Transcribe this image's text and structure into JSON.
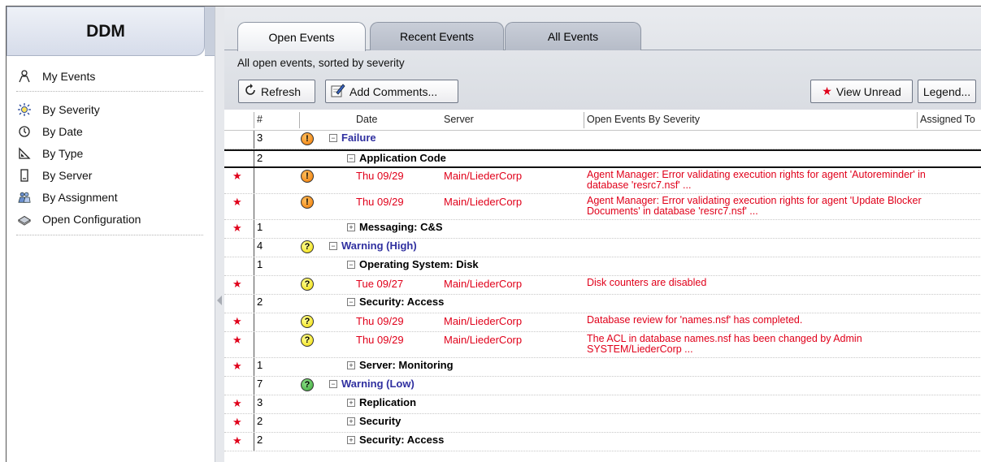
{
  "sidebar": {
    "title": "DDM",
    "items": [
      {
        "label": "My Events",
        "icon": "person-icon"
      },
      {
        "label": "By Severity",
        "icon": "severity-icon"
      },
      {
        "label": "By Date",
        "icon": "clock-icon"
      },
      {
        "label": "By Type",
        "icon": "type-icon"
      },
      {
        "label": "By Server",
        "icon": "server-icon"
      },
      {
        "label": "By Assignment",
        "icon": "people-icon"
      },
      {
        "label": "Open Configuration",
        "icon": "configuration-icon"
      }
    ]
  },
  "tabs": [
    {
      "label": "Open Events",
      "active": true
    },
    {
      "label": "Recent Events",
      "active": false
    },
    {
      "label": "All Events",
      "active": false
    }
  ],
  "subtitle": "All open events, sorted by severity",
  "toolbar": {
    "refresh_label": "Refresh",
    "add_comments_label": "Add Comments...",
    "view_unread_label": "View Unread",
    "legend_label": "Legend..."
  },
  "columns": {
    "count": "#",
    "date": "Date",
    "server": "Server",
    "summary": "Open Events By Severity",
    "assigned": "Assigned To"
  },
  "rows": [
    {
      "kind": "cat1",
      "count": "3",
      "severity": "fail",
      "label": "Failure",
      "expanded": true
    },
    {
      "kind": "cat2",
      "count": "2",
      "label": "Application Code",
      "expanded": true,
      "selected": true
    },
    {
      "kind": "event",
      "unread": true,
      "severity": "fail",
      "date": "Thu 09/29",
      "server": "Main/LiederCorp",
      "message": "Agent Manager: Error validating execution rights for agent 'Autoreminder' in database 'resrc7.nsf' ..."
    },
    {
      "kind": "event",
      "unread": true,
      "severity": "fail",
      "date": "Thu 09/29",
      "server": "Main/LiederCorp",
      "message": "Agent Manager: Error validating execution rights for agent 'Update Blocker Documents' in database 'resrc7.nsf' ..."
    },
    {
      "kind": "cat2",
      "unread": true,
      "count": "1",
      "label": "Messaging: C&S",
      "expanded": false
    },
    {
      "kind": "cat1",
      "count": "4",
      "severity": "high",
      "label": "Warning (High)",
      "expanded": true
    },
    {
      "kind": "cat2",
      "count": "1",
      "label": "Operating System: Disk",
      "expanded": true
    },
    {
      "kind": "event",
      "unread": true,
      "severity": "high",
      "date": "Tue 09/27",
      "server": "Main/LiederCorp",
      "message": "Disk counters are disabled"
    },
    {
      "kind": "cat2",
      "count": "2",
      "label": "Security: Access",
      "expanded": true
    },
    {
      "kind": "event",
      "unread": true,
      "severity": "high",
      "date": "Thu 09/29",
      "server": "Main/LiederCorp",
      "message": "Database review for 'names.nsf' has completed."
    },
    {
      "kind": "event",
      "unread": true,
      "severity": "high",
      "date": "Thu 09/29",
      "server": "Main/LiederCorp",
      "message": "The ACL in database names.nsf has been changed by Admin SYSTEM/LiederCorp ..."
    },
    {
      "kind": "cat2",
      "unread": true,
      "count": "1",
      "label": "Server: Monitoring",
      "expanded": false
    },
    {
      "kind": "cat1",
      "count": "7",
      "severity": "low",
      "label": "Warning (Low)",
      "expanded": true
    },
    {
      "kind": "cat2",
      "unread": true,
      "count": "3",
      "label": "Replication",
      "expanded": false
    },
    {
      "kind": "cat2",
      "unread": true,
      "count": "2",
      "label": "Security",
      "expanded": false
    },
    {
      "kind": "cat2",
      "unread": true,
      "count": "2",
      "label": "Security: Access",
      "expanded": false
    }
  ]
}
